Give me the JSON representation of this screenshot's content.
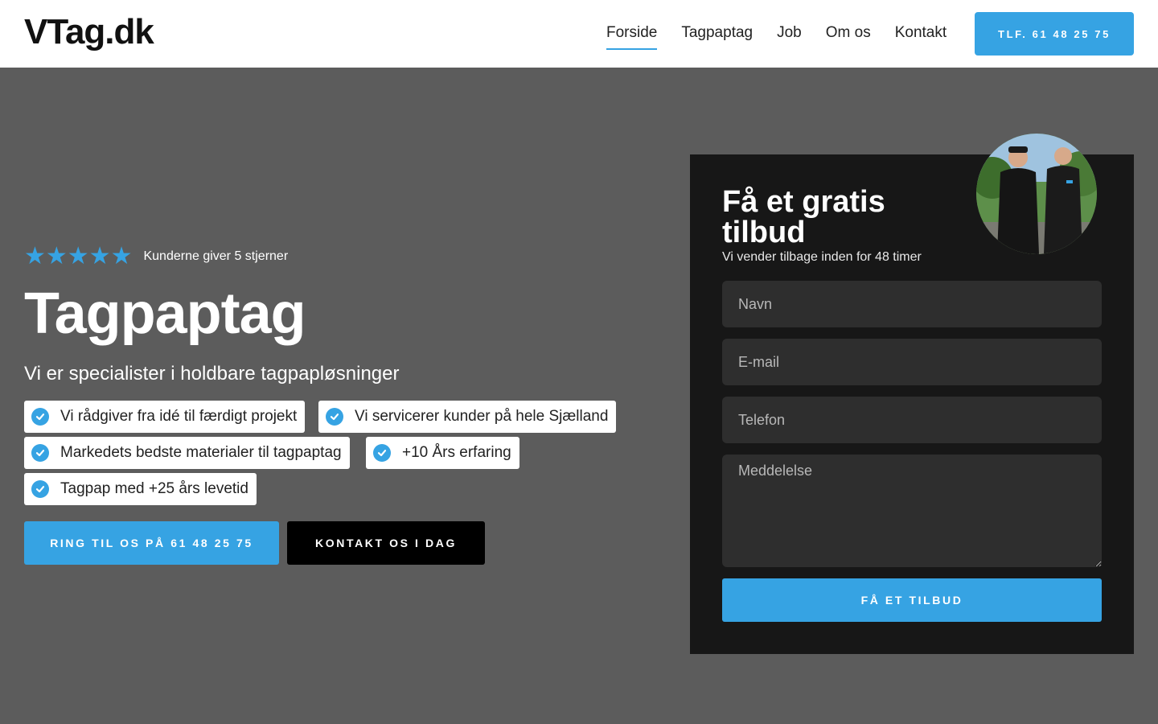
{
  "header": {
    "logo": "VTag.dk",
    "nav": [
      {
        "label": "Forside",
        "active": true
      },
      {
        "label": "Tagpaptag"
      },
      {
        "label": "Job"
      },
      {
        "label": "Om os"
      },
      {
        "label": "Kontakt"
      }
    ],
    "phone_button": "TLF. 61 48 25 75"
  },
  "hero": {
    "stars": "★★★★★",
    "rating_text": "Kunderne giver 5 stjerner",
    "title": "Tagpaptag",
    "subtitle": "Vi er specialister i holdbare tagpapløsninger",
    "features": [
      "Vi rådgiver fra idé til færdigt projekt",
      "Vi servicerer kunder på hele Sjælland",
      "Markedets bedste materialer til tagpaptag",
      "+10 Års erfaring",
      "Tagpap med +25 års levetid"
    ],
    "cta_call": "RING TIL OS PÅ 61 48 25 75",
    "cta_contact": "KONTAKT OS I DAG"
  },
  "form": {
    "title": "Få et gratis tilbud",
    "subtitle": "Vi vender tilbage inden for 48 timer",
    "name_placeholder": "Navn",
    "email_placeholder": "E-mail",
    "phone_placeholder": "Telefon",
    "message_placeholder": "Meddelelse",
    "submit_label": "FÅ ET TILBUD"
  },
  "colors": {
    "accent": "#36a3e3",
    "hero_bg": "#5c5c5c",
    "card_bg": "#171717"
  }
}
